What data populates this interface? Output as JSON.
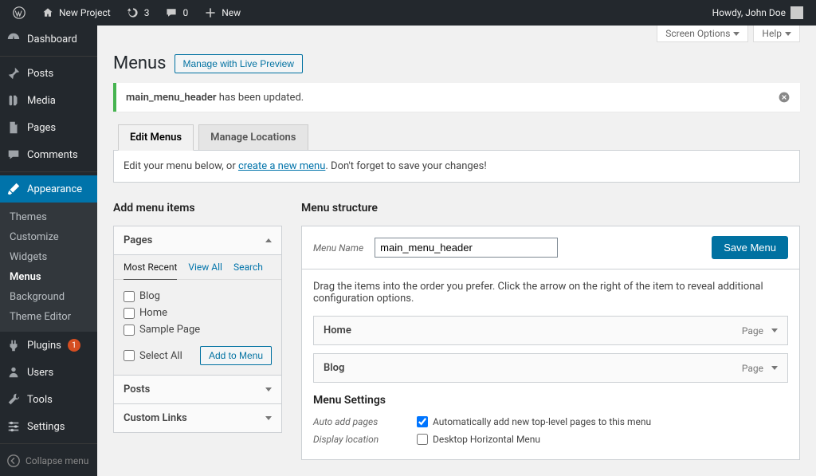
{
  "admin_bar": {
    "site_name": "New Project",
    "updates": "3",
    "comments": "0",
    "new_label": "New",
    "howdy": "Howdy, John Doe"
  },
  "sidebar": {
    "items": [
      {
        "label": "Dashboard"
      },
      {
        "label": "Posts"
      },
      {
        "label": "Media"
      },
      {
        "label": "Pages"
      },
      {
        "label": "Comments"
      },
      {
        "label": "Appearance"
      },
      {
        "label": "Plugins"
      },
      {
        "label": "Users"
      },
      {
        "label": "Tools"
      },
      {
        "label": "Settings"
      }
    ],
    "submenu": {
      "items": [
        {
          "label": "Themes"
        },
        {
          "label": "Customize"
        },
        {
          "label": "Widgets"
        },
        {
          "label": "Menus"
        },
        {
          "label": "Background"
        },
        {
          "label": "Theme Editor"
        }
      ]
    },
    "plugins_badge": "1",
    "collapse_label": "Collapse menu"
  },
  "screen_tabs": {
    "options": "Screen Options",
    "help": "Help"
  },
  "heading": {
    "title": "Menus",
    "live_preview": "Manage with Live Preview"
  },
  "notice": {
    "strong": "main_menu_header",
    "rest": " has been updated."
  },
  "tabs": {
    "edit": "Edit Menus",
    "locations": "Manage Locations"
  },
  "help_text": {
    "before": "Edit your menu below, or ",
    "link": "create a new menu",
    "after": ". Don't forget to save your changes!"
  },
  "add_items": {
    "heading": "Add menu items",
    "pages": {
      "header": "Pages",
      "tabs": {
        "recent": "Most Recent",
        "view_all": "View All",
        "search": "Search"
      },
      "items": [
        "Blog",
        "Home",
        "Sample Page"
      ],
      "select_all": "Select All",
      "add_btn": "Add to Menu"
    },
    "posts": {
      "header": "Posts"
    },
    "custom_links": {
      "header": "Custom Links"
    }
  },
  "structure": {
    "heading": "Menu structure",
    "name_label": "Menu Name",
    "name_value": "main_menu_header",
    "save_btn": "Save Menu",
    "instructions": "Drag the items into the order you prefer. Click the arrow on the right of the item to reveal additional configuration options.",
    "items": [
      {
        "title": "Home",
        "type": "Page"
      },
      {
        "title": "Blog",
        "type": "Page"
      }
    ]
  },
  "settings": {
    "heading": "Menu Settings",
    "auto_label": "Auto add pages",
    "auto_opt": "Automatically add new top-level pages to this menu",
    "loc_label": "Display location",
    "loc_opt": "Desktop Horizontal Menu"
  }
}
